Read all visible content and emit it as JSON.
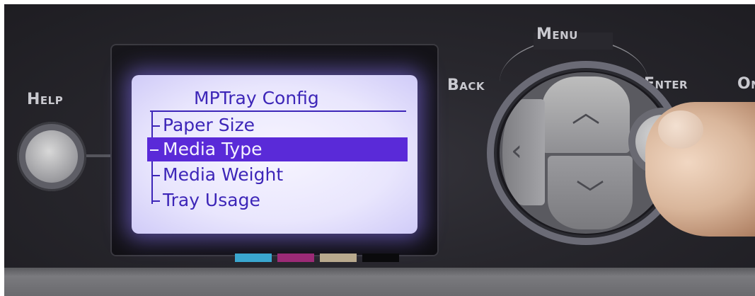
{
  "panel": {
    "labels": {
      "help": "Help",
      "back": "Back",
      "menu": "Menu",
      "enter": "Enter",
      "on": "On"
    }
  },
  "lcd": {
    "title": "MPTray Config",
    "items": [
      {
        "label": "Paper Size",
        "selected": false
      },
      {
        "label": "Media Type",
        "selected": true
      },
      {
        "label": "Media Weight",
        "selected": false
      },
      {
        "label": "Tray Usage",
        "selected": false
      }
    ]
  },
  "colors": {
    "lcd_text": "#3d26b8",
    "lcd_highlight": "#5a2ad8",
    "lcd_background": "#e9e6fd",
    "toner_swatches": [
      "#3aa6cf",
      "#9b2a76",
      "#b8a98d",
      "#0a0a0c"
    ]
  },
  "icons": {
    "up": "chevron-up-icon",
    "down": "chevron-down-icon",
    "left": "chevron-left-icon"
  }
}
